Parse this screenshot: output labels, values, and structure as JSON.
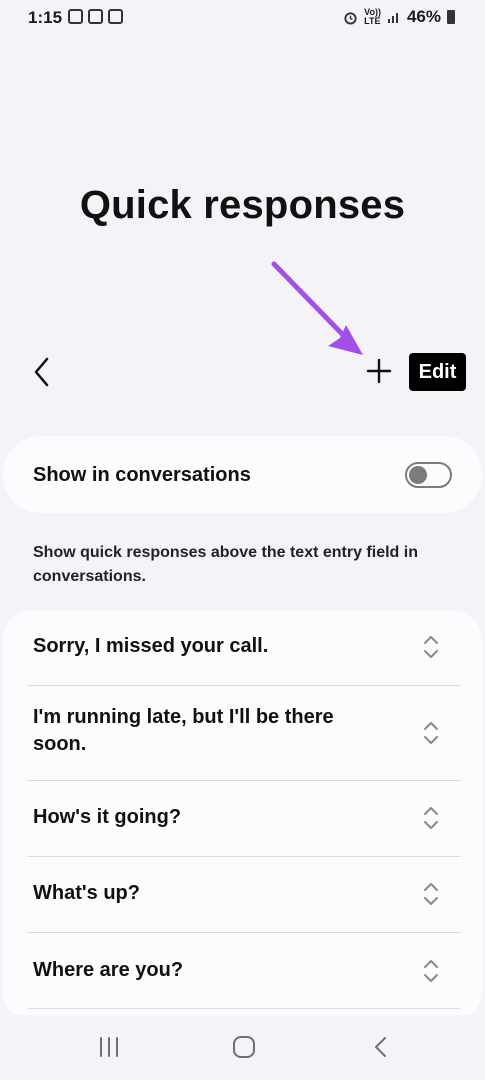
{
  "status_bar": {
    "time": "1:15",
    "volte_top": "Vo))",
    "volte_bottom": "LTE",
    "battery": "46%"
  },
  "header": {
    "title": "Quick responses",
    "back_icon": "chevron-left-icon",
    "add_icon": "plus-icon",
    "edit_label": "Edit"
  },
  "toggle": {
    "label": "Show in conversations",
    "enabled": false
  },
  "description": "Show quick responses above the text entry field in conversations.",
  "responses": [
    {
      "text": "Sorry, I missed your call."
    },
    {
      "text": "I'm running late, but I'll be there soon."
    },
    {
      "text": "How's it going?"
    },
    {
      "text": "What's up?"
    },
    {
      "text": "Where are you?"
    }
  ],
  "nav": {
    "recents_icon": "recents-icon",
    "home_icon": "home-icon",
    "back_icon": "back-icon"
  },
  "colors": {
    "background": "#f4f3f8",
    "card": "#fcfcfe",
    "annotation_arrow": "#a34fe8",
    "edit_button": "#000000"
  }
}
